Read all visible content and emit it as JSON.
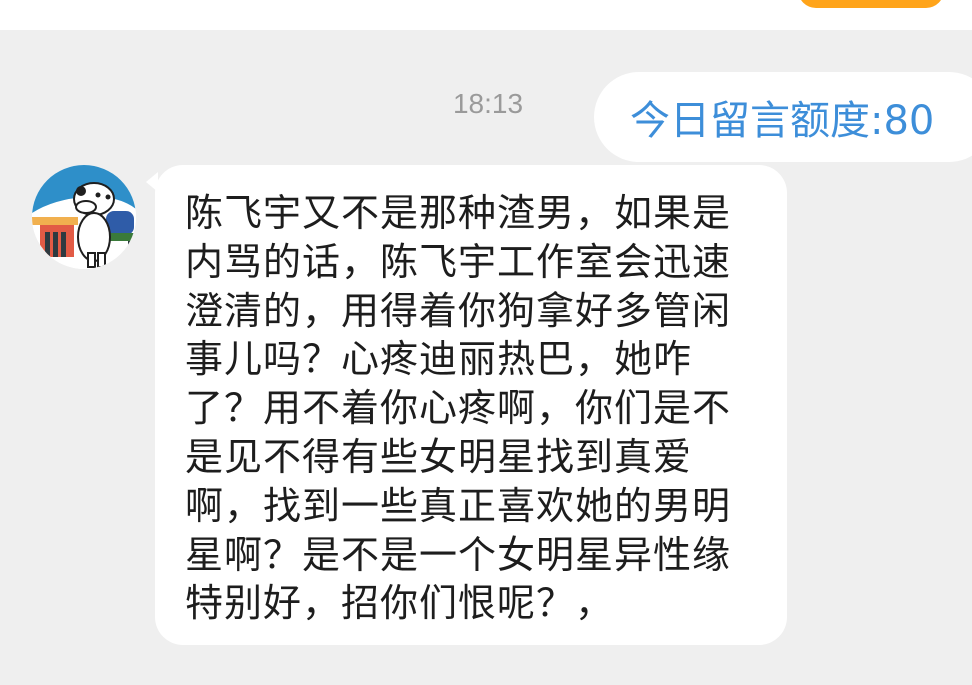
{
  "header": {
    "accent_color": "#ffa41a"
  },
  "chat": {
    "timestamp": "18:13",
    "quota_label": "今日留言额度:80",
    "quota_color": "#3d8ed9",
    "message": {
      "avatar_icon": "cartoon-dog-avatar-icon",
      "text": "陈飞宇又不是那种渣男，如果是内骂的话，陈飞宇工作室会迅速澄清的，用得着你狗拿好多管闲事儿吗？心疼迪丽热巴，她咋了？用不着你心疼啊，你们是不是见不得有些女明星找到真爱啊，找到一些真正喜欢她的男明星啊？是不是一个女明星异性缘特别好，招你们恨呢？，"
    }
  }
}
